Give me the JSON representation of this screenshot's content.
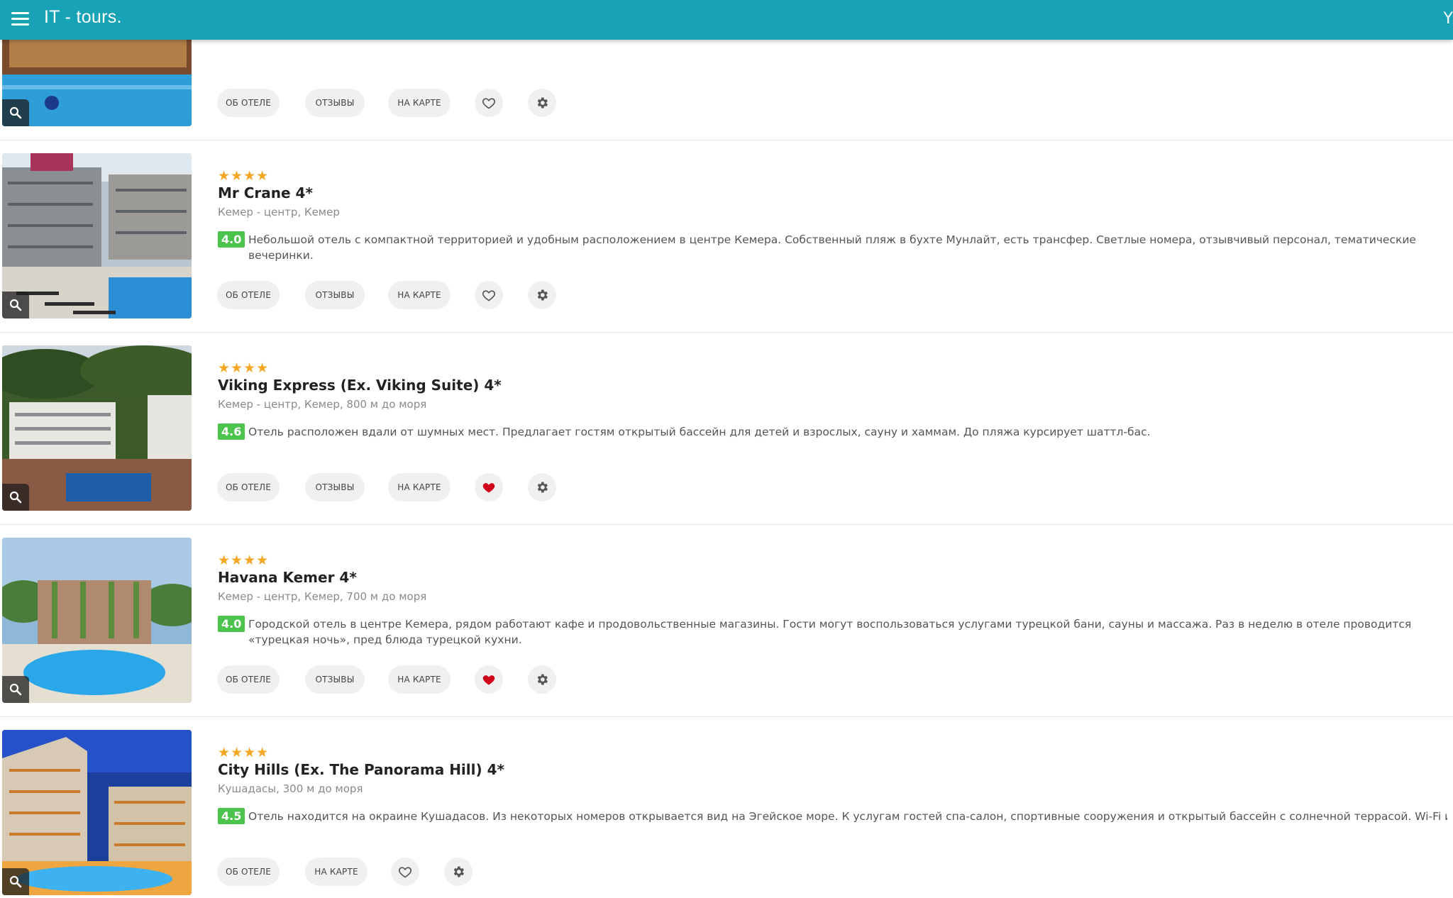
{
  "app": {
    "title": "IT - tours.",
    "edge_char": "Y"
  },
  "buttons": {
    "about": "ОБ ОТЕЛЕ",
    "reviews": "ОТЗЫВЫ",
    "map": "НА КАРТЕ"
  },
  "colors": {
    "topbar": "#17a2b6",
    "rating": "#4cc34c",
    "star": "#f5a623",
    "favorite": "#d0021b"
  },
  "hotels": [
    {
      "stars": "",
      "name": "",
      "location": "",
      "rating": "",
      "description": "",
      "favorite": false
    },
    {
      "stars": "★★★★",
      "name": "Mr Crane 4*",
      "location": "Кемер - центр, Кемер",
      "rating": "4.0",
      "description": "Небольшой отель с компактной территорией и удобным расположением в центре Кемера. Собственный пляж в бухте Мунлайт, есть трансфер. Светлые номера, отзывчивый персонал, тематические вечеринки.",
      "favorite": false
    },
    {
      "stars": "★★★★",
      "name": "Viking Express (Ex. Viking Suite) 4*",
      "location": "Кемер - центр, Кемер, 800 м до моря",
      "rating": "4.6",
      "description": "Отель расположен вдали от шумных мест. Предлагает гостям открытый бассейн для детей и взрослых, сауну и хаммам. До пляжа курсирует шаттл-бас.",
      "favorite": true
    },
    {
      "stars": "★★★★",
      "name": "Havana Kemer 4*",
      "location": "Кемер - центр, Кемер, 700 м до моря",
      "rating": "4.0",
      "description": "Городской отель в центре Кемера, рядом работают кафе и продовольственные магазины. Гости могут воспользоваться услугами турецкой бани, сауны и массажа. Раз в неделю в отеле проводится «турецкая ночь», пред блюда турецкой кухни.",
      "favorite": true
    },
    {
      "stars": "★★★★",
      "name": "City Hills (Ex. The Panorama Hill) 4*",
      "location": "Кушадасы, 300 м до моря",
      "rating": "4.5",
      "description": "Отель находится на окраине Кушадасов. Из некоторых номеров открывается вид на Эгейское море. К услугам гостей спа-салон, спортивные сооружения и открытый бассейн с солнечной террасой. Wi-Fi и парковка пред",
      "favorite": false
    }
  ]
}
